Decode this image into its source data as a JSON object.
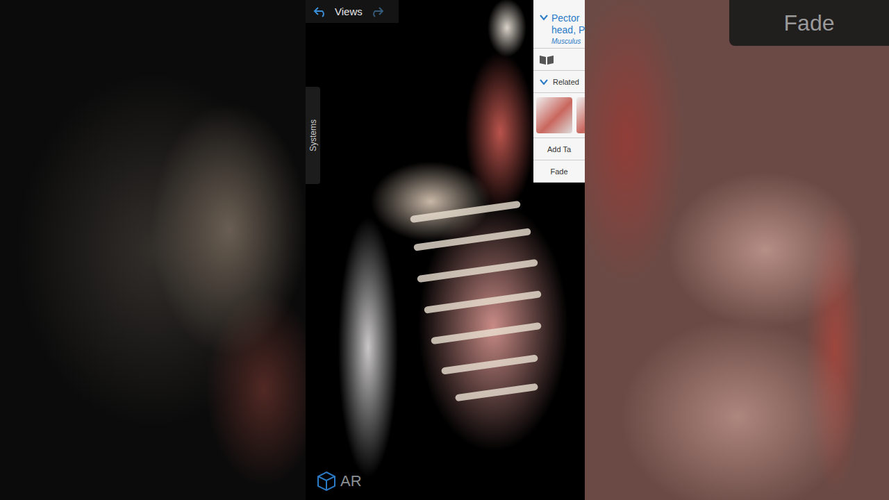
{
  "top_bar": {
    "label": "Views"
  },
  "side_tab": {
    "label": "Systems"
  },
  "info_panel": {
    "expanded": true,
    "title_lines": [
      "Pector",
      "head, P"
    ],
    "subtitle": "Musculus",
    "related": {
      "label": "Related",
      "expanded": true
    },
    "add_tag": "Add Ta",
    "fade": "Fade"
  },
  "ar_button": {
    "label": "AR"
  },
  "background_right": {
    "fade_label": "Fade"
  }
}
